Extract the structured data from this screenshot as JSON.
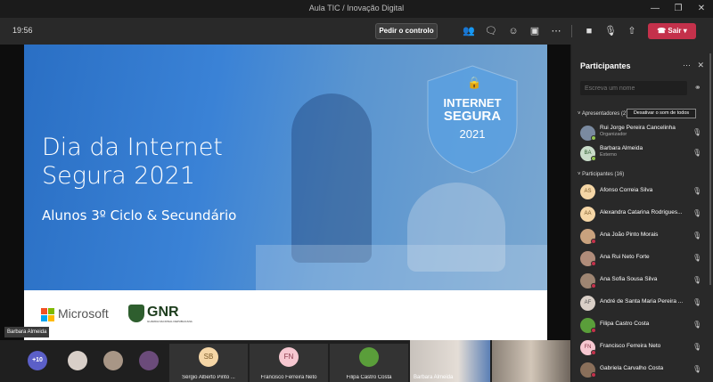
{
  "window": {
    "title": "Aula TIC / Inovação Digital",
    "controls": [
      "—",
      "❐",
      "✕"
    ]
  },
  "toolbar": {
    "clock": "19:56",
    "control_label": "Pedir o controlo",
    "leave_label": "Sair",
    "icons": [
      "people-icon",
      "chat-icon",
      "reactions-icon",
      "rooms-icon",
      "more-icon",
      "camera-icon",
      "mic-icon",
      "share-icon"
    ]
  },
  "slide": {
    "title_line1": "Dia da Internet",
    "title_line2": "Segura 2021",
    "subtitle": "Alunos 3º Ciclo & Secundário",
    "badge_line1": "INTERNET",
    "badge_line2": "SEGURA",
    "badge_year": "2021",
    "logo_microsoft": "Microsoft",
    "logo_gnr": "GNR",
    "logo_gnr_sub": "GUARDA NACIONAL REPUBLICANA"
  },
  "presenter_label": "Barbara Almeida",
  "gallery": {
    "overflow": "+10",
    "tiles": [
      {
        "name": "Sérgio Alberto Pinto ...",
        "initials": "SB",
        "color": "#f5d6a6"
      },
      {
        "name": "Francisco Ferreira Neto",
        "initials": "FN",
        "color": "#f6c7d0"
      },
      {
        "name": "Filipa Castro Costa",
        "initials": "",
        "color": "#5a9e3a"
      },
      {
        "name": "Barbara Almeida",
        "initials": "",
        "color": ""
      }
    ]
  },
  "panel": {
    "title": "Participantes",
    "search_placeholder": "Escreva um nome",
    "presenters_label": "Apresentadores (2)",
    "mute_all": "Desativar o som de todos",
    "attendees_label": "Participantes (16)",
    "presenters": [
      {
        "name": "Rui Jorge Pereira Cancelinha",
        "role": "Organizador",
        "initials": "",
        "color": "#7a8aa0",
        "status": "#92c353"
      },
      {
        "name": "Barbara Almeida",
        "role": "Externo",
        "initials": "BA",
        "color": "#c9dcc9",
        "status": "#92c353"
      }
    ],
    "attendees": [
      {
        "name": "Afonso Correia Silva",
        "initials": "AS",
        "color": "#f5d6a6"
      },
      {
        "name": "Alexandra Catarina Rodrigues...",
        "initials": "AA",
        "color": "#f5d6a6"
      },
      {
        "name": "Ana João Pinto Morais",
        "initials": "",
        "color": "#c9a27e"
      },
      {
        "name": "Ana Rui Neto Forte",
        "initials": "",
        "color": "#b08c7a"
      },
      {
        "name": "Ana Sofia Sousa Silva",
        "initials": "",
        "color": "#9e8572"
      },
      {
        "name": "André de Santa Maria Pereira ...",
        "initials": "AF",
        "color": "#d9cfc7"
      },
      {
        "name": "Filipa Castro Costa",
        "initials": "",
        "color": "#5a9e3a"
      },
      {
        "name": "Francisco Ferreira Neto",
        "initials": "FN",
        "color": "#f6c7d0"
      },
      {
        "name": "Gabriela Carvalho Costa",
        "initials": "",
        "color": "#8a6f5a"
      }
    ]
  }
}
